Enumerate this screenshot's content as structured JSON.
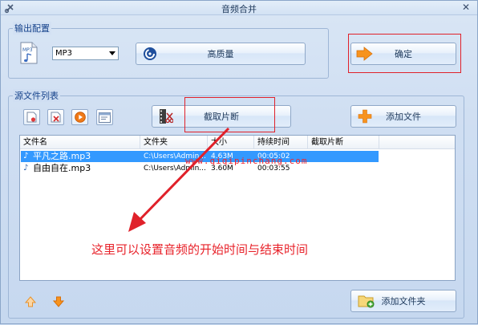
{
  "window": {
    "title": "音频合并",
    "close_glyph": "✕"
  },
  "output_group": {
    "label": "输出配置",
    "format_icon_text": "MP3",
    "format_select": {
      "value": "MP3"
    },
    "quality_button": "高质量",
    "confirm_button": "确定"
  },
  "source_group": {
    "label": "源文件列表",
    "clip_button": "截取片断",
    "add_file_button": "添加文件",
    "add_folder_button": "添加文件夹",
    "columns": [
      "文件名",
      "文件夹",
      "大小",
      "持续时间",
      "截取片断"
    ],
    "rows": [
      {
        "name": "平凡之路.mp3",
        "folder": "C:\\Users\\Admin...",
        "size": "4.63M",
        "duration": "00:05:02",
        "clip": "",
        "selected": true
      },
      {
        "name": "自由自在.mp3",
        "folder": "C:\\Users\\Admin...",
        "size": "3.60M",
        "duration": "00:03:55",
        "clip": "",
        "selected": false
      }
    ]
  },
  "overlay": {
    "watermark": "www.qiqipinchang.com",
    "annotation": "这里可以设置音频的开始时间与结束时间"
  },
  "colors": {
    "accent_red": "#e0212a",
    "selection": "#3399ff",
    "orange_arrow": "#f7931e"
  }
}
